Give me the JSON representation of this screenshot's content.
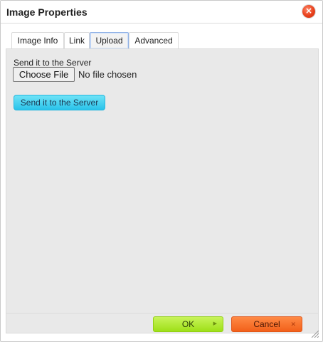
{
  "dialog": {
    "title": "Image Properties",
    "close_icon": "close-icon"
  },
  "tabs": [
    {
      "label": "Image Info",
      "active": false
    },
    {
      "label": "Link",
      "active": false
    },
    {
      "label": "Upload",
      "active": true
    },
    {
      "label": "Advanced",
      "active": false
    }
  ],
  "upload": {
    "label": "Send it to the Server",
    "choose_file_label": "Choose File",
    "file_status": "No file chosen",
    "send_button_label": "Send it to the Server"
  },
  "footer": {
    "ok_label": "OK",
    "cancel_label": "Cancel"
  },
  "colors": {
    "ok_button": "#9ee018",
    "cancel_button": "#f2601a",
    "send_button": "#29c3ea",
    "close_button": "#e8401c"
  }
}
